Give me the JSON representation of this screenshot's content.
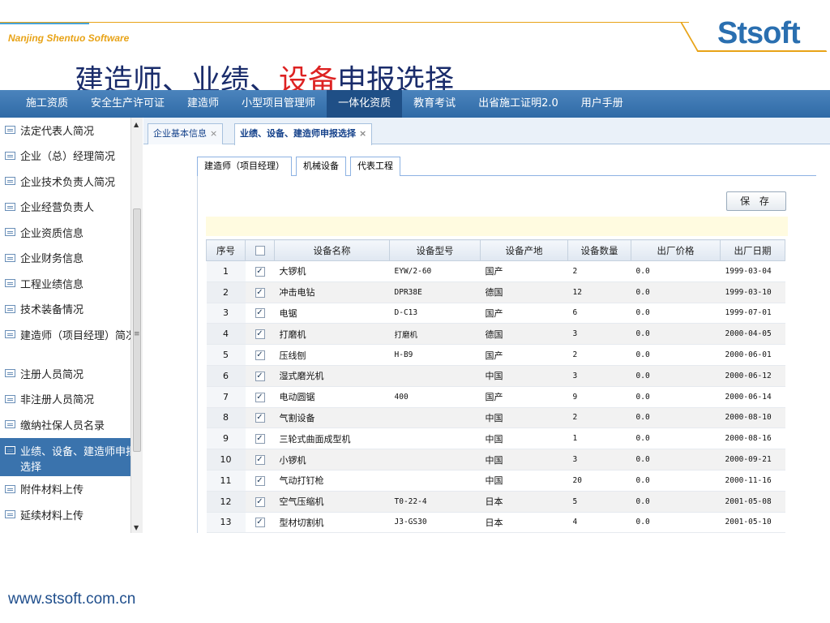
{
  "brand": {
    "tagline": "Nanjing Shentuo Software",
    "logo": "Stsoft",
    "url": "www.stsoft.com.cn"
  },
  "slide_title": {
    "part1": "建造师、业绩、",
    "highlight": "设备",
    "part2": "申报选择"
  },
  "topnav": [
    "施工资质",
    "安全生产许可证",
    "建造师",
    "小型项目管理师",
    "一体化资质",
    "教育考试",
    "出省施工证明2.0",
    "用户手册"
  ],
  "sidebar": [
    "法定代表人简况",
    "企业（总）经理简况",
    "企业技术负责人简况",
    "企业经营负责人",
    "企业资质信息",
    "企业财务信息",
    "工程业绩信息",
    "技术装备情况",
    "建造师（项目经理）简况",
    "注册人员简况",
    "非注册人员简况",
    "缴纳社保人员名录",
    "业绩、设备、建造师申报选择",
    "附件材料上传",
    "延续材料上传"
  ],
  "tabs": [
    {
      "label": "企业基本信息"
    },
    {
      "label": "业绩、设备、建造师申报选择"
    }
  ],
  "subtabs": [
    "建造师（项目经理）",
    "机械设备",
    "代表工程"
  ],
  "save_label": "保 存",
  "grid": {
    "columns": [
      "序号",
      "",
      "设备名称",
      "设备型号",
      "设备产地",
      "设备数量",
      "出厂价格",
      "出厂日期"
    ],
    "rows": [
      [
        "1",
        "大锣机",
        "EYW/2-60",
        "国产",
        "2",
        "0.0",
        "1999-03-04"
      ],
      [
        "2",
        "冲击电钻",
        "DPR38E",
        "德国",
        "12",
        "0.0",
        "1999-03-10"
      ],
      [
        "3",
        "电锯",
        "D-C13",
        "国产",
        "6",
        "0.0",
        "1999-07-01"
      ],
      [
        "4",
        "打磨机",
        "打磨机",
        "德国",
        "3",
        "0.0",
        "2000-04-05"
      ],
      [
        "5",
        "压线刨",
        "H-B9",
        "国产",
        "2",
        "0.0",
        "2000-06-01"
      ],
      [
        "6",
        "湿式磨光机",
        "",
        "中国",
        "3",
        "0.0",
        "2000-06-12"
      ],
      [
        "7",
        "电动圆锯",
        "400",
        "国产",
        "9",
        "0.0",
        "2000-06-14"
      ],
      [
        "8",
        "气割设备",
        "",
        "中国",
        "2",
        "0.0",
        "2000-08-10"
      ],
      [
        "9",
        "三轮式曲面成型机",
        "",
        "中国",
        "1",
        "0.0",
        "2000-08-16"
      ],
      [
        "10",
        "小锣机",
        "",
        "中国",
        "3",
        "0.0",
        "2000-09-21"
      ],
      [
        "11",
        "气动打钉枪",
        "",
        "中国",
        "20",
        "0.0",
        "2000-11-16"
      ],
      [
        "12",
        "空气压缩机",
        "T0-22-4",
        "日本",
        "5",
        "0.0",
        "2001-05-08"
      ],
      [
        "13",
        "型材切割机",
        "J3-GS30",
        "日本",
        "4",
        "0.0",
        "2001-05-10"
      ]
    ]
  },
  "colors": {
    "nav": "#3a73ad",
    "title": "#1a2c6b",
    "highlight": "#dd2222",
    "brand_orange": "#e8a317"
  }
}
